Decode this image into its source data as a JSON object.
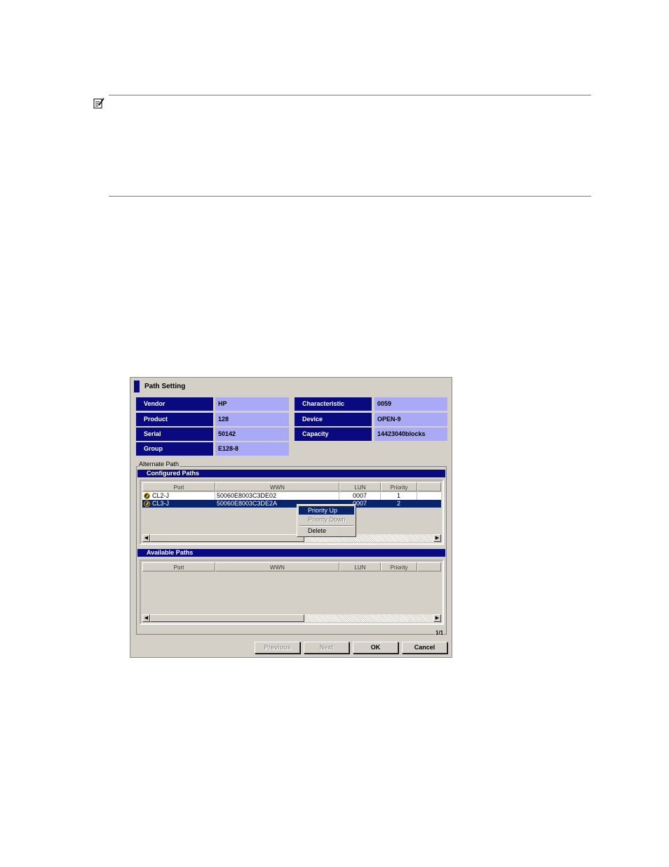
{
  "dialog": {
    "title": "Path Setting",
    "info": {
      "vendor_label": "Vendor",
      "vendor_value": "HP",
      "product_label": "Product",
      "product_value": "128",
      "serial_label": "Serial",
      "serial_value": "50142",
      "group_label": "Group",
      "group_value": "E128-8",
      "characteristic_label": "Characteristic",
      "characteristic_value": "0059",
      "device_label": "Device",
      "device_value": "OPEN-9",
      "capacity_label": "Capacity",
      "capacity_value": "14423040blocks"
    },
    "alternate_path_label": "Alternate Path",
    "configured": {
      "title": "Configured Paths",
      "columns": [
        "Port",
        "WWN",
        "LUN",
        "Priority"
      ],
      "rows": [
        {
          "port": "CL2-J",
          "wwn": "50060E8003C3DE02",
          "lun": "0007",
          "priority": "1",
          "selected": false
        },
        {
          "port": "CL3-J",
          "wwn": "50060E8003C3DE2A",
          "lun": "0007",
          "priority": "2",
          "selected": true
        }
      ]
    },
    "available": {
      "title": "Available Paths",
      "columns": [
        "Port",
        "WWN",
        "LUN",
        "Priority"
      ]
    },
    "context_menu": {
      "priority_up": "Priority Up",
      "priority_down": "Priority Down",
      "delete": "Delete"
    },
    "page_indicator": "1/1",
    "buttons": {
      "previous": "Previous",
      "next": "Next",
      "ok": "OK",
      "cancel": "Cancel"
    }
  },
  "colors": {
    "header_bar": "#0a0a80",
    "value_cell": "#a9a9f6",
    "selection": "#0a246a",
    "rule": "#2a9aa3"
  }
}
